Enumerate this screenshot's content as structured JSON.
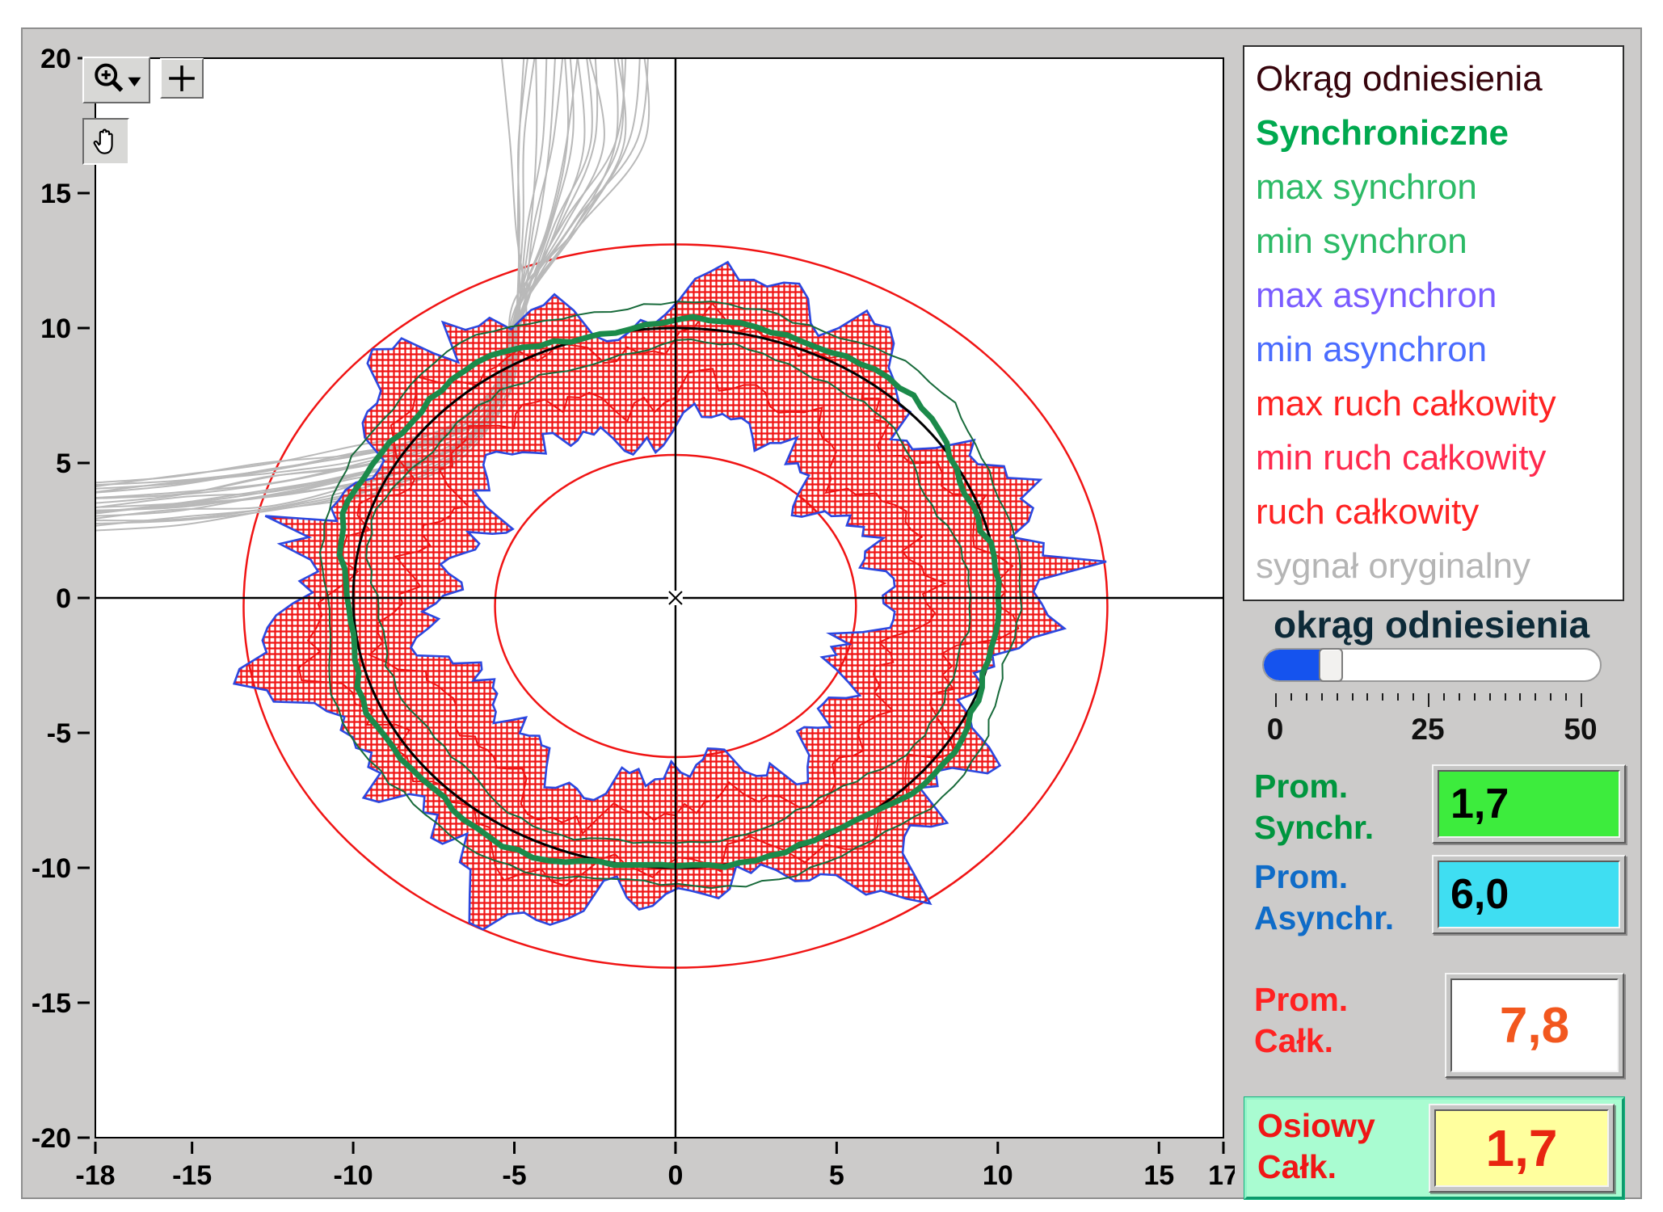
{
  "toolbar": {
    "buttons": [
      {
        "name": "zoom-tool",
        "icon": "magnifier-with-dropdown-icon"
      },
      {
        "name": "crosshair-tool",
        "icon": "plus-crosshair-icon"
      },
      {
        "name": "pan-tool",
        "icon": "hand-icon"
      }
    ]
  },
  "legend": {
    "items": [
      {
        "label": "Okrąg odniesienia",
        "color": "#36040c",
        "bold": false
      },
      {
        "label": "Synchroniczne",
        "color": "#00a94f",
        "bold": true
      },
      {
        "label": "max synchron",
        "color": "#2cba66",
        "bold": false
      },
      {
        "label": "min synchron",
        "color": "#2cba66",
        "bold": false
      },
      {
        "label": "max asynchron",
        "color": "#7a5cff",
        "bold": false
      },
      {
        "label": "min asynchron",
        "color": "#4a6cff",
        "bold": false
      },
      {
        "label": "max ruch całkowity",
        "color": "#ff2222",
        "bold": false
      },
      {
        "label": "min ruch całkowity",
        "color": "#ff2a4e",
        "bold": false
      },
      {
        "label": "ruch całkowity",
        "color": "#ff2222",
        "bold": false
      },
      {
        "label": "sygnał oryginalny",
        "color": "#b5b5b5",
        "bold": false
      }
    ]
  },
  "slider": {
    "label": "okrąg odniesienia",
    "min": 0,
    "max": 50,
    "value": 10,
    "tick_labels": [
      "0",
      "25",
      "50"
    ],
    "fill_color": "#1553ee"
  },
  "indicators": {
    "synchr": {
      "line1": "Prom.",
      "line2": "Synchr.",
      "value": "1,7",
      "label_color": "#00963f",
      "box_bg": "#3dec3d",
      "value_color": "#000000"
    },
    "asynchr": {
      "line1": "Prom.",
      "line2": "Asynchr.",
      "value": "6,0",
      "label_color": "#0f6cc8",
      "box_bg": "#3fdef2",
      "value_color": "#000000"
    },
    "calk": {
      "line1": "Prom.",
      "line2": "Całk.",
      "value": "7,8",
      "label_color": "#ff2222",
      "box_bg": "#ffffff",
      "value_color": "#f2571e"
    },
    "osiowy": {
      "line1": "Osiowy",
      "line2": "Całk.",
      "value": "1,7",
      "label_color": "#f01616",
      "box_bg": "#ffff9e",
      "value_color": "#e82410",
      "panel_bg": "#a9fcd1",
      "panel_border": "#10b47e"
    }
  },
  "chart_data": {
    "type": "line",
    "title": "",
    "xlabel": "",
    "ylabel": "",
    "xlim": [
      -18,
      17
    ],
    "ylim": [
      -20,
      20
    ],
    "x_ticks": [
      -18,
      -15,
      -10,
      -5,
      0,
      5,
      10,
      15,
      17
    ],
    "y_ticks": [
      20,
      15,
      10,
      5,
      0,
      -5,
      -10,
      -15,
      -20
    ],
    "grid": false,
    "legend_position": "right",
    "center_marker": [
      0,
      0
    ],
    "series": [
      {
        "name": "okrąg odniesienia",
        "kind": "circle",
        "center": [
          0,
          0
        ],
        "radius": 10,
        "color": "#000000",
        "width": 3
      },
      {
        "name": "okrąg pomocniczy wewnętrzny",
        "kind": "circle",
        "center": [
          0,
          -0.3
        ],
        "radius": 5.6,
        "color": "#f01414",
        "width": 2.5
      },
      {
        "name": "okrąg pomocniczy zewnętrzny",
        "kind": "circle",
        "center": [
          0,
          -0.3
        ],
        "radius": 13.4,
        "color": "#f01414",
        "width": 2.5
      },
      {
        "name": "Synchroniczne",
        "kind": "wobble-circle",
        "center": [
          -0.2,
          0.1
        ],
        "radius": 10.25,
        "color": "#1b8a4a",
        "width": 7
      },
      {
        "name": "max synchron",
        "kind": "wobble-circle",
        "center": [
          -0.2,
          0.1
        ],
        "radius": 11.0,
        "color": "#176a3a",
        "width": 2
      },
      {
        "name": "min synchron",
        "kind": "wobble-circle",
        "center": [
          -0.2,
          0.1
        ],
        "radius": 9.2,
        "color": "#176a3a",
        "width": 2
      },
      {
        "name": "ruch całkowity",
        "kind": "jagged-ring",
        "center": [
          -0.5,
          -0.2
        ],
        "inner_radius": 6.6,
        "outer_radius": 11.4,
        "jag": 1.1,
        "fill": "red-hatch",
        "hatch_color": "#f01414",
        "edge_color": "#2b47e0"
      },
      {
        "name": "sygnał oryginalny",
        "kind": "signal-bundle",
        "color": "#b9b9b9",
        "curves": 22,
        "path": "left edge y≈4 → corner (-5.5,6.5) → top edge x≈-4"
      }
    ]
  }
}
